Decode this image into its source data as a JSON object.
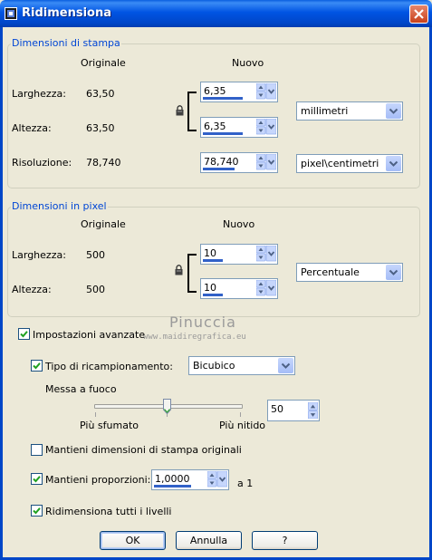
{
  "window": {
    "title": "Ridimensiona"
  },
  "print_group": {
    "title": "Dimensioni di stampa",
    "col_original": "Originale",
    "col_new": "Nuovo",
    "width_label": "Larghezza:",
    "width_original": "63,50",
    "width_new": "6,35",
    "height_label": "Altezza:",
    "height_original": "63,50",
    "height_new": "6,35",
    "units": "millimetri",
    "resolution_label": "Risoluzione:",
    "resolution_original": "78,740",
    "resolution_new": "78,740",
    "resolution_units": "pixel\\centimetri"
  },
  "pixel_group": {
    "title": "Dimensioni in pixel",
    "col_original": "Originale",
    "col_new": "Nuovo",
    "width_label": "Larghezza:",
    "width_original": "500",
    "width_new": "10",
    "height_label": "Altezza:",
    "height_original": "500",
    "height_new": "10",
    "units": "Percentuale"
  },
  "watermark": {
    "name": "Pinuccia",
    "url": "www.maidiregrafica.eu"
  },
  "advanced": {
    "label": "Impostazioni avanzate",
    "checked": true
  },
  "resample": {
    "label": "Tipo di ricampionamento:",
    "checked": true,
    "value": "Bicubico"
  },
  "sharpen": {
    "label": "Messa a fuoco",
    "min_label": "Più sfumato",
    "max_label": "Più nitido",
    "value": "50"
  },
  "keep_print_size": {
    "label": "Mantieni dimensioni di stampa originali",
    "checked": false
  },
  "keep_ratio": {
    "label": "Mantieni proporzioni:",
    "checked": true,
    "value": "1,0000",
    "suffix": "a 1"
  },
  "resize_all_layers": {
    "label": "Ridimensiona tutti i livelli",
    "checked": true
  },
  "buttons": {
    "ok": "OK",
    "cancel": "Annulla",
    "help": "?"
  },
  "colors": {
    "title_bar": "#0054E3",
    "group_label": "#0046D5",
    "dialog_bg": "#ECE9D8",
    "close_button": "#D2542F"
  },
  "icons": [
    "app-icon",
    "close-icon",
    "lock-icon",
    "spin-up-icon",
    "spin-down-icon",
    "dropdown-arrow-icon",
    "checkmark-icon"
  ]
}
